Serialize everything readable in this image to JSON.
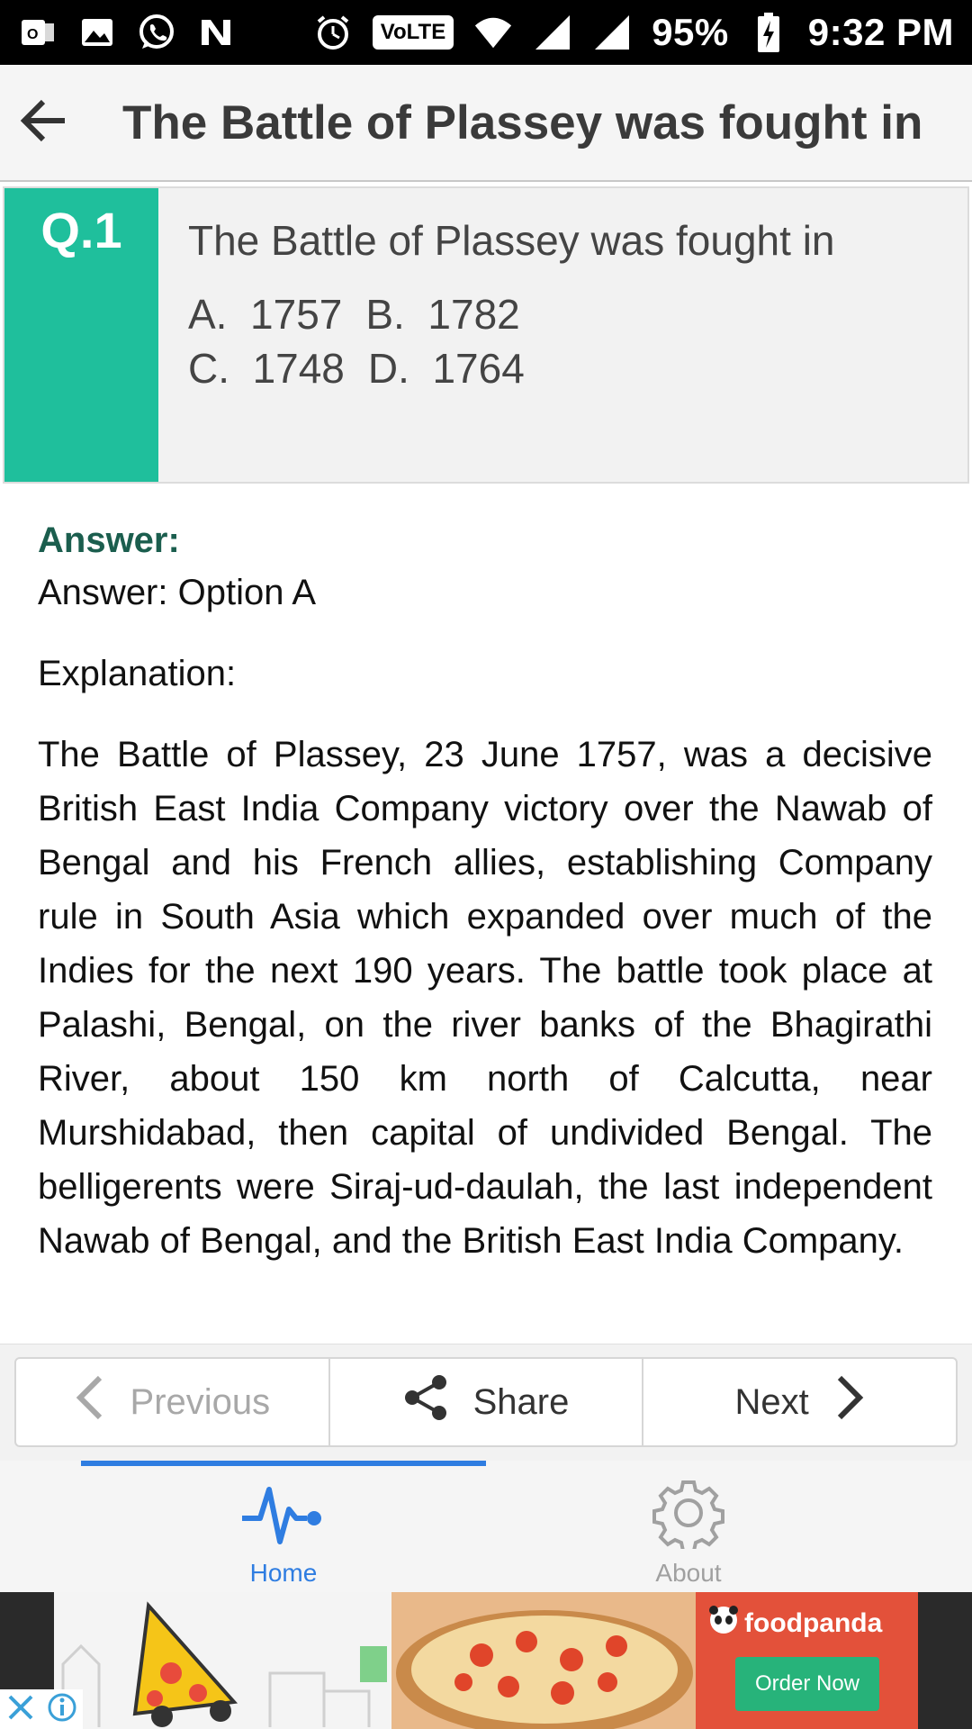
{
  "status_bar": {
    "battery": "95%",
    "time": "9:32 PM",
    "volte": "VoLTE",
    "icons": [
      "outlook-icon",
      "gallery-icon",
      "whatsapp-icon",
      "n-app-icon",
      "alarm-icon",
      "volte-icon",
      "wifi-icon",
      "signal-icon",
      "signal-icon",
      "battery-charging-icon"
    ]
  },
  "app_bar": {
    "title": "The Battle of Plassey was fought in"
  },
  "question": {
    "number": "Q.1",
    "text": "The Battle of Plassey was fought in",
    "options": [
      {
        "letter": "A.",
        "value": "1757"
      },
      {
        "letter": "B.",
        "value": "1782"
      },
      {
        "letter": "C.",
        "value": "1748"
      },
      {
        "letter": "D.",
        "value": "1764"
      }
    ]
  },
  "answer": {
    "heading": "Answer:",
    "answer_line": "Answer: Option A",
    "explanation_label": "Explanation:",
    "explanation_text": "The Battle of Plassey, 23 June 1757, was a decisive British East India Company victory over the Nawab of Bengal and his French allies, establishing Company rule in South Asia which expanded over much of the Indies for the next 190 years. The battle took place at Palashi, Bengal, on the river banks of the Bhagirathi River, about 150 km north of Calcutta, near Murshidabad, then capital of undivided Bengal. The belligerents were Siraj-ud-daulah, the last independent Nawab of Bengal, and the British East India Company."
  },
  "navigation": {
    "previous": "Previous",
    "share": "Share",
    "next": "Next"
  },
  "tabs": {
    "home": "Home",
    "about": "About"
  },
  "ad": {
    "brand": "foodpanda",
    "cta": "Order Now"
  },
  "colors": {
    "accent_teal": "#1fbf9c",
    "answer_heading": "#1b5e4e",
    "tab_active": "#2f7de1"
  }
}
